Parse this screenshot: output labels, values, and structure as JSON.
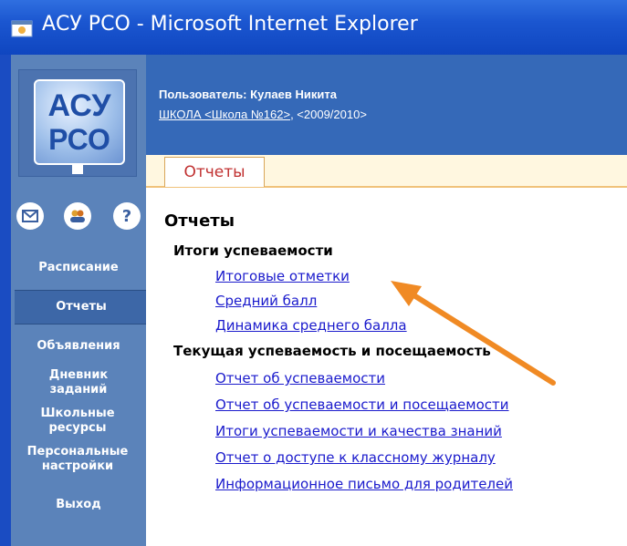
{
  "window": {
    "title": "АСУ РСО - Microsoft Internet Explorer"
  },
  "logo": {
    "line1": "АСУ",
    "line2": "РСО"
  },
  "sidebar": {
    "icons": [
      "mail-icon",
      "users-icon",
      "help-icon"
    ],
    "items": [
      {
        "label": "Расписание"
      },
      {
        "label": "Отчеты"
      },
      {
        "label": "Объявления"
      },
      {
        "label": "Дневник заданий"
      },
      {
        "label": "Школьные ресурсы"
      },
      {
        "label": "Персональные настройки"
      },
      {
        "label": "Выход"
      }
    ],
    "active_index": 1
  },
  "header": {
    "user": "Пользователь: Кулаев Никита",
    "school_link": "ШКОЛА <Школа №162>",
    "school_year": ", <2009/2010>"
  },
  "tabs": [
    {
      "label": "Отчеты"
    }
  ],
  "content": {
    "title": "Отчеты",
    "sections": [
      {
        "title": "Итоги успеваемости",
        "links": [
          "Итоговые отметки",
          "Средний балл",
          "Динамика среднего балла"
        ]
      },
      {
        "title": "Текущая успеваемость и посещаемость",
        "links": [
          "Отчет об успеваемости",
          "Отчет об успеваемости и посещаемости",
          "Итоги успеваемости и качества знаний",
          "Отчет о доступе к классному журналу",
          "Информационное письмо для родителей"
        ]
      }
    ]
  },
  "colors": {
    "titlebar": "#1b56d0",
    "sidebar": "#5b83ba",
    "header": "#3569b8",
    "link": "#1a1acc",
    "tab_text": "#c03030",
    "annotation_arrow": "#f08a24"
  }
}
